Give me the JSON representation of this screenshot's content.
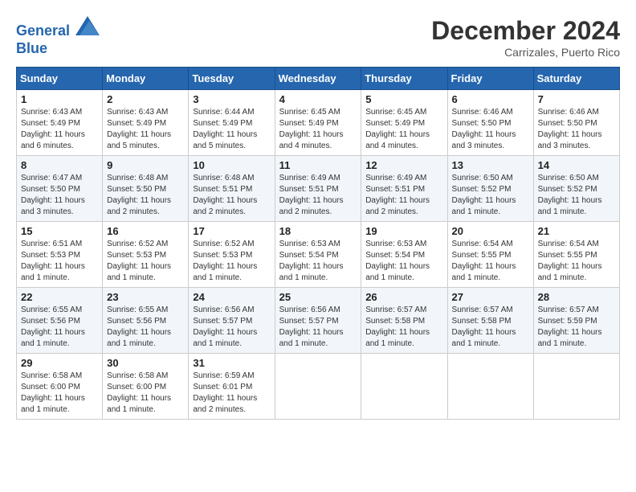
{
  "header": {
    "logo_line1": "General",
    "logo_line2": "Blue",
    "month": "December 2024",
    "location": "Carrizales, Puerto Rico"
  },
  "days_of_week": [
    "Sunday",
    "Monday",
    "Tuesday",
    "Wednesday",
    "Thursday",
    "Friday",
    "Saturday"
  ],
  "weeks": [
    [
      {
        "day": "1",
        "info": "Sunrise: 6:43 AM\nSunset: 5:49 PM\nDaylight: 11 hours\nand 6 minutes."
      },
      {
        "day": "2",
        "info": "Sunrise: 6:43 AM\nSunset: 5:49 PM\nDaylight: 11 hours\nand 5 minutes."
      },
      {
        "day": "3",
        "info": "Sunrise: 6:44 AM\nSunset: 5:49 PM\nDaylight: 11 hours\nand 5 minutes."
      },
      {
        "day": "4",
        "info": "Sunrise: 6:45 AM\nSunset: 5:49 PM\nDaylight: 11 hours\nand 4 minutes."
      },
      {
        "day": "5",
        "info": "Sunrise: 6:45 AM\nSunset: 5:49 PM\nDaylight: 11 hours\nand 4 minutes."
      },
      {
        "day": "6",
        "info": "Sunrise: 6:46 AM\nSunset: 5:50 PM\nDaylight: 11 hours\nand 3 minutes."
      },
      {
        "day": "7",
        "info": "Sunrise: 6:46 AM\nSunset: 5:50 PM\nDaylight: 11 hours\nand 3 minutes."
      }
    ],
    [
      {
        "day": "8",
        "info": "Sunrise: 6:47 AM\nSunset: 5:50 PM\nDaylight: 11 hours\nand 3 minutes."
      },
      {
        "day": "9",
        "info": "Sunrise: 6:48 AM\nSunset: 5:50 PM\nDaylight: 11 hours\nand 2 minutes."
      },
      {
        "day": "10",
        "info": "Sunrise: 6:48 AM\nSunset: 5:51 PM\nDaylight: 11 hours\nand 2 minutes."
      },
      {
        "day": "11",
        "info": "Sunrise: 6:49 AM\nSunset: 5:51 PM\nDaylight: 11 hours\nand 2 minutes."
      },
      {
        "day": "12",
        "info": "Sunrise: 6:49 AM\nSunset: 5:51 PM\nDaylight: 11 hours\nand 2 minutes."
      },
      {
        "day": "13",
        "info": "Sunrise: 6:50 AM\nSunset: 5:52 PM\nDaylight: 11 hours\nand 1 minute."
      },
      {
        "day": "14",
        "info": "Sunrise: 6:50 AM\nSunset: 5:52 PM\nDaylight: 11 hours\nand 1 minute."
      }
    ],
    [
      {
        "day": "15",
        "info": "Sunrise: 6:51 AM\nSunset: 5:53 PM\nDaylight: 11 hours\nand 1 minute."
      },
      {
        "day": "16",
        "info": "Sunrise: 6:52 AM\nSunset: 5:53 PM\nDaylight: 11 hours\nand 1 minute."
      },
      {
        "day": "17",
        "info": "Sunrise: 6:52 AM\nSunset: 5:53 PM\nDaylight: 11 hours\nand 1 minute."
      },
      {
        "day": "18",
        "info": "Sunrise: 6:53 AM\nSunset: 5:54 PM\nDaylight: 11 hours\nand 1 minute."
      },
      {
        "day": "19",
        "info": "Sunrise: 6:53 AM\nSunset: 5:54 PM\nDaylight: 11 hours\nand 1 minute."
      },
      {
        "day": "20",
        "info": "Sunrise: 6:54 AM\nSunset: 5:55 PM\nDaylight: 11 hours\nand 1 minute."
      },
      {
        "day": "21",
        "info": "Sunrise: 6:54 AM\nSunset: 5:55 PM\nDaylight: 11 hours\nand 1 minute."
      }
    ],
    [
      {
        "day": "22",
        "info": "Sunrise: 6:55 AM\nSunset: 5:56 PM\nDaylight: 11 hours\nand 1 minute."
      },
      {
        "day": "23",
        "info": "Sunrise: 6:55 AM\nSunset: 5:56 PM\nDaylight: 11 hours\nand 1 minute."
      },
      {
        "day": "24",
        "info": "Sunrise: 6:56 AM\nSunset: 5:57 PM\nDaylight: 11 hours\nand 1 minute."
      },
      {
        "day": "25",
        "info": "Sunrise: 6:56 AM\nSunset: 5:57 PM\nDaylight: 11 hours\nand 1 minute."
      },
      {
        "day": "26",
        "info": "Sunrise: 6:57 AM\nSunset: 5:58 PM\nDaylight: 11 hours\nand 1 minute."
      },
      {
        "day": "27",
        "info": "Sunrise: 6:57 AM\nSunset: 5:58 PM\nDaylight: 11 hours\nand 1 minute."
      },
      {
        "day": "28",
        "info": "Sunrise: 6:57 AM\nSunset: 5:59 PM\nDaylight: 11 hours\nand 1 minute."
      }
    ],
    [
      {
        "day": "29",
        "info": "Sunrise: 6:58 AM\nSunset: 6:00 PM\nDaylight: 11 hours\nand 1 minute."
      },
      {
        "day": "30",
        "info": "Sunrise: 6:58 AM\nSunset: 6:00 PM\nDaylight: 11 hours\nand 1 minute."
      },
      {
        "day": "31",
        "info": "Sunrise: 6:59 AM\nSunset: 6:01 PM\nDaylight: 11 hours\nand 2 minutes."
      },
      {
        "day": "",
        "info": ""
      },
      {
        "day": "",
        "info": ""
      },
      {
        "day": "",
        "info": ""
      },
      {
        "day": "",
        "info": ""
      }
    ]
  ]
}
